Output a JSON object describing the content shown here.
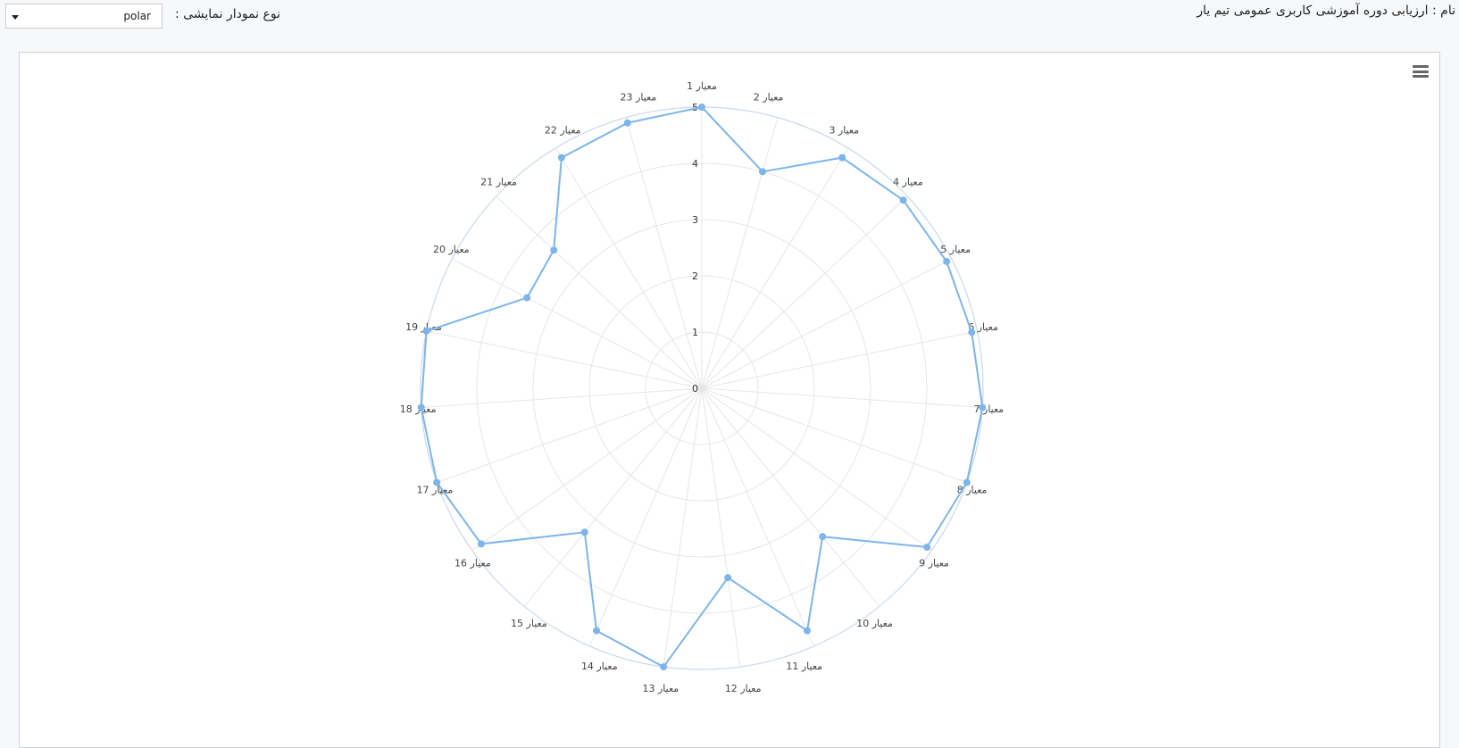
{
  "header": {
    "title": "نام : ارزیابی دوره آموزشی کاربری عمومی تیم یار",
    "chart_type_label": "نوع نمودار نمایشی :",
    "chart_type_value": "polar"
  },
  "icons": {
    "menu": "hamburger-menu-icon",
    "dropdown": "caret-down-icon"
  },
  "colors": {
    "series": "#7cb5ec",
    "grid": "#e6e6e6",
    "outer_ring": "#ccd6eb"
  },
  "chart_data": {
    "type": "polar",
    "categories": [
      "معیار 1",
      "معیار 2",
      "معیار 3",
      "معیار 4",
      "معیار 5",
      "معیار 6",
      "معیار 7",
      "معیار 8",
      "معیار 9",
      "معیار 10",
      "معیار 11",
      "معیار 12",
      "معیار 13",
      "معیار 14",
      "معیار 15",
      "معیار 16",
      "معیار 17",
      "معیار 18",
      "معیار 19",
      "معیار 20",
      "معیار 21",
      "معیار 22",
      "معیار 23"
    ],
    "series": [
      {
        "values": [
          5.0,
          4.0,
          4.8,
          4.9,
          4.9,
          4.9,
          5.0,
          5.0,
          4.9,
          3.4,
          4.7,
          3.4,
          5.0,
          4.7,
          3.3,
          4.8,
          5.0,
          5.0,
          5.0,
          3.5,
          3.6,
          4.8,
          4.9
        ]
      }
    ],
    "ylim": [
      0,
      5
    ],
    "yticks": [
      "0",
      "1",
      "2",
      "3",
      "4",
      "5"
    ],
    "grid": true,
    "legend": false
  }
}
